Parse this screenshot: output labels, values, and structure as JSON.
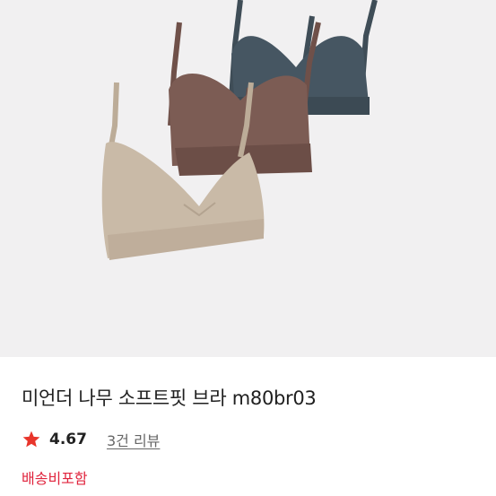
{
  "product": {
    "image_alt": "3 color wireless bras: beige, brown, navy",
    "title": "미언더 나무 소프트핏 브라 m80br03",
    "rating": "4.67",
    "review_count_text": "3건 리뷰",
    "shipping_text": "배송비포함",
    "colors": {
      "background": "#f1f0f1",
      "beige": "#c8b9a6",
      "brown": "#7a5a52",
      "navy": "#3f4d57",
      "star": "#e8352b",
      "shipping": "#e0243d"
    }
  }
}
